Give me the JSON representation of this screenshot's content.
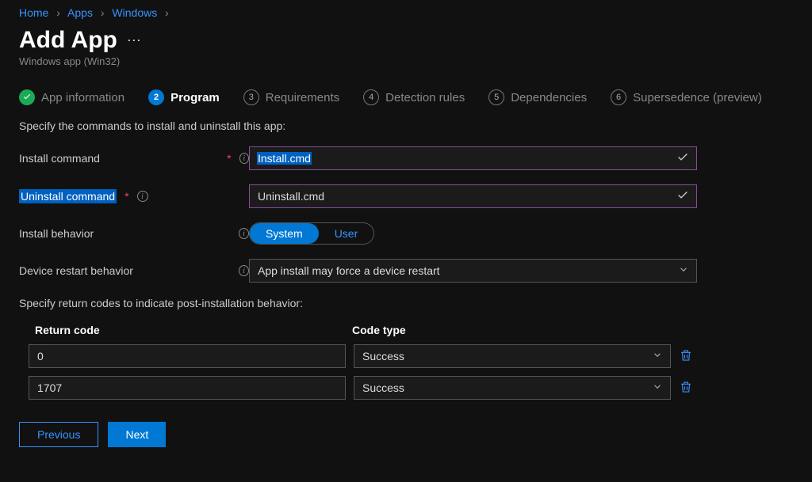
{
  "breadcrumb": {
    "items": [
      "Home",
      "Apps",
      "Windows"
    ]
  },
  "header": {
    "title": "Add App",
    "subtitle": "Windows app (Win32)"
  },
  "tabs": [
    {
      "label": "App information"
    },
    {
      "label": "Program"
    },
    {
      "label": "Requirements",
      "num": "3"
    },
    {
      "label": "Detection rules",
      "num": "4"
    },
    {
      "label": "Dependencies",
      "num": "5"
    },
    {
      "label": "Supersedence (preview)",
      "num": "6"
    }
  ],
  "instructions": {
    "commands": "Specify the commands to install and uninstall this app:",
    "return_codes": "Specify return codes to indicate post-installation behavior:"
  },
  "form": {
    "install_command": {
      "label": "Install command",
      "value": "Install.cmd"
    },
    "uninstall_command": {
      "label": "Uninstall command",
      "value": "Uninstall.cmd"
    },
    "install_behavior": {
      "label": "Install behavior",
      "options": [
        "System",
        "User"
      ],
      "selected": 0
    },
    "device_restart": {
      "label": "Device restart behavior",
      "value": "App install may force a device restart"
    }
  },
  "table": {
    "headers": {
      "return_code": "Return code",
      "code_type": "Code type"
    },
    "rows": [
      {
        "return_code": "0",
        "code_type": "Success"
      },
      {
        "return_code": "1707",
        "code_type": "Success"
      }
    ]
  },
  "footer": {
    "previous": "Previous",
    "next": "Next"
  }
}
